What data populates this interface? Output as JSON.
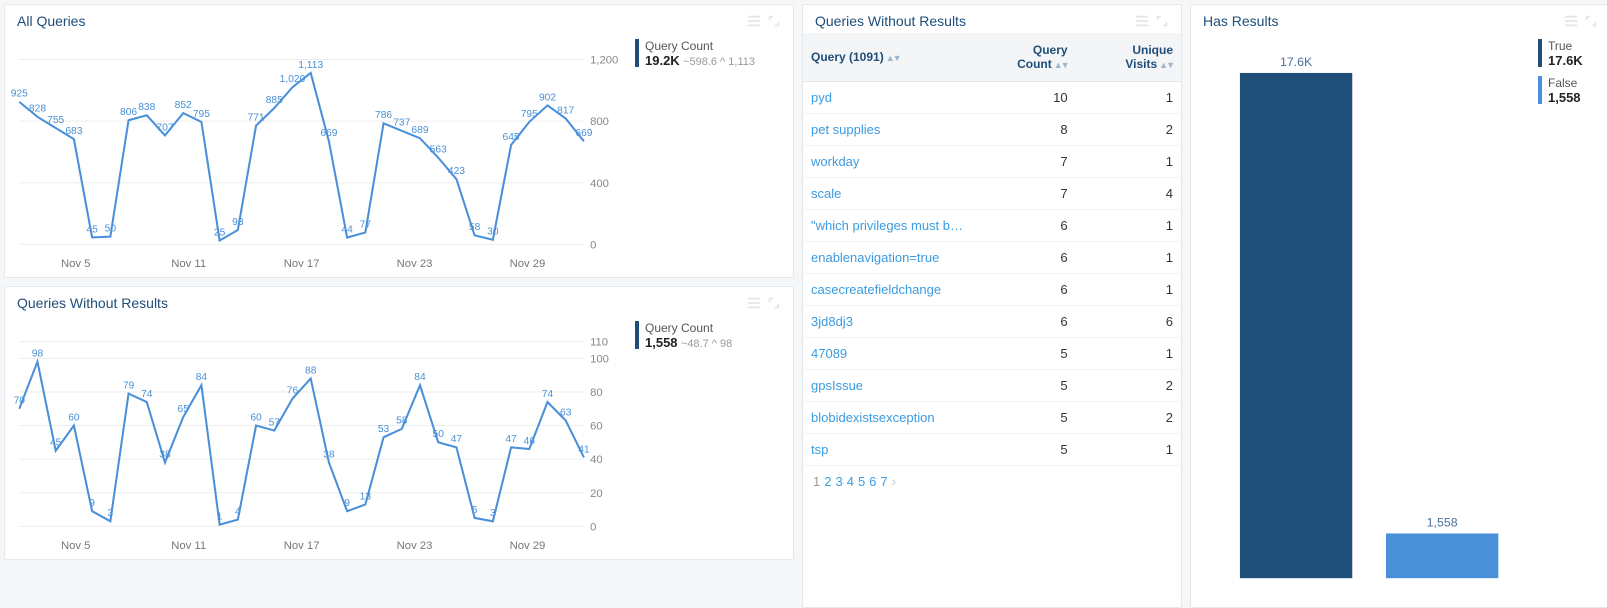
{
  "panels": {
    "all_queries": {
      "title": "All Queries",
      "legend": {
        "label": "Query Count",
        "value": "19.2K",
        "trend": "~598.6 ^ 1,113"
      }
    },
    "no_results_trend": {
      "title": "Queries Without Results",
      "legend": {
        "label": "Query Count",
        "value": "1,558",
        "trend": "~48.7 ^ 98"
      }
    },
    "no_results_table": {
      "title": "Queries Without Results",
      "col_query": "Query (1091)",
      "col_count": "Query Count",
      "col_visits": "Unique Visits",
      "rows": [
        {
          "q": "pyd",
          "c": "10",
          "v": "1"
        },
        {
          "q": "pet supplies",
          "c": "8",
          "v": "2"
        },
        {
          "q": "workday",
          "c": "7",
          "v": "1"
        },
        {
          "q": "scale",
          "c": "7",
          "v": "4"
        },
        {
          "q": "\"which privileges must be set …",
          "c": "6",
          "v": "1"
        },
        {
          "q": "enablenavigation=true",
          "c": "6",
          "v": "1"
        },
        {
          "q": "casecreatefieldchange",
          "c": "6",
          "v": "1"
        },
        {
          "q": "3jd8dj3",
          "c": "6",
          "v": "6"
        },
        {
          "q": "47089",
          "c": "5",
          "v": "1"
        },
        {
          "q": "gpsIssue",
          "c": "5",
          "v": "2"
        },
        {
          "q": "blobidexistsexception",
          "c": "5",
          "v": "2"
        },
        {
          "q": "tsp",
          "c": "5",
          "v": "1"
        }
      ],
      "pages": [
        "1",
        "2",
        "3",
        "4",
        "5",
        "6",
        "7"
      ]
    },
    "has_results": {
      "title": "Has Results",
      "true_label": "True",
      "true_value": "17.6K",
      "false_label": "False",
      "false_value": "1,558",
      "bar_labels": {
        "true": "17.6K",
        "false": "1,558"
      }
    }
  },
  "chart_data": [
    {
      "id": "all_queries",
      "type": "line",
      "title": "All Queries",
      "ylabel": "Query Count",
      "ylim": [
        0,
        1200
      ],
      "y_ticks": [
        0,
        400,
        800,
        1200
      ],
      "x_ticks": [
        "Nov 5",
        "Nov 11",
        "Nov 17",
        "Nov 23",
        "Nov 29"
      ],
      "series": [
        {
          "name": "Query Count",
          "values": [
            925,
            828,
            755,
            683,
            45,
            50,
            806,
            838,
            707,
            852,
            795,
            25,
            93,
            771,
            885,
            1020,
            1113,
            669,
            44,
            77,
            786,
            737,
            689,
            563,
            423,
            58,
            30,
            645,
            795,
            902,
            817,
            669
          ]
        }
      ]
    },
    {
      "id": "no_results_trend",
      "type": "line",
      "title": "Queries Without Results",
      "ylabel": "Query Count",
      "ylim": [
        0,
        110
      ],
      "y_ticks": [
        0,
        20,
        40,
        60,
        80,
        100,
        110
      ],
      "x_ticks": [
        "Nov 5",
        "Nov 11",
        "Nov 17",
        "Nov 23",
        "Nov 29"
      ],
      "series": [
        {
          "name": "Query Count",
          "values": [
            70,
            98,
            45,
            60,
            9,
            3,
            79,
            74,
            38,
            65,
            84,
            1,
            4,
            60,
            57,
            76,
            88,
            38,
            9,
            13,
            53,
            58,
            84,
            50,
            47,
            5,
            3,
            47,
            46,
            74,
            63,
            41
          ]
        }
      ]
    },
    {
      "id": "has_results",
      "type": "bar",
      "title": "Has Results",
      "categories": [
        "True",
        "False"
      ],
      "values": [
        17600,
        1558
      ],
      "ylim": [
        0,
        18000
      ]
    }
  ]
}
